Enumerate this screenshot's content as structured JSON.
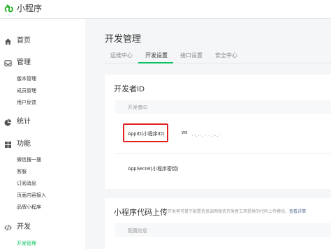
{
  "app": {
    "name": "小程序"
  },
  "sidebar": {
    "home": "首页",
    "manage": "管理",
    "manage_items": [
      "版本管理",
      "成员管理",
      "用户反馈"
    ],
    "stats": "统计",
    "features": "功能",
    "feature_items": [
      "微信搜一搜",
      "客服",
      "订阅消息",
      "页面内容接入",
      "品牌小程序"
    ],
    "dev": "开发",
    "dev_items": [
      "开发管理"
    ]
  },
  "page": {
    "title": "开发管理",
    "tabs": [
      "运维中心",
      "开发设置",
      "接口设置",
      "安全中心"
    ],
    "active_tab": "开发设置"
  },
  "developer_id": {
    "title": "开发者ID",
    "header": "开发者ID",
    "appid_label": "AppID(小程序ID)",
    "appid_value": "wx",
    "appsecret_label": "AppSecret(小程序密钥)"
  },
  "upload": {
    "title": "小程序代码上传",
    "description": "开发者可基于配置信息调用微信开发者工具提供的代码上传模块。",
    "link": "查看详情",
    "header": "配置信息"
  },
  "colors": {
    "accent": "#07c160",
    "highlight": "#e02020",
    "link": "#576b95"
  }
}
